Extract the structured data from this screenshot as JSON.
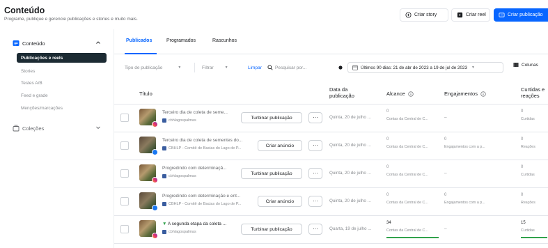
{
  "header": {
    "title": "Conteúdo",
    "subtitle": "Programe, publique e gerencie publicações e stories e muito mais.",
    "buttons": {
      "create_story": "Criar story",
      "create_reel": "Criar reel",
      "create_post": "Criar publicação"
    }
  },
  "sidebar": {
    "content_label": "Conteúdo",
    "sub_items": [
      "Publicações e reels",
      "Stories",
      "Testes A/B",
      "Feed e grade",
      "Menções/marcações"
    ],
    "collections_label": "Coleções"
  },
  "tabs": [
    "Publicados",
    "Programados",
    "Rascunhos"
  ],
  "filters": {
    "post_type": "Tipo de publicação",
    "filter": "Filtrar",
    "clear": "Limpar",
    "search": "Pesquisar por...",
    "date_range": "Últimos 90 dias: 21 de abr de 2023 a 19 de jul de 2023",
    "columns": "Colunas"
  },
  "table": {
    "headers": {
      "title": "Título",
      "date_l1": "Data da",
      "date_l2": "publicação",
      "reach": "Alcance",
      "engagement": "Engajamentos",
      "likes_l1": "Curtidas e",
      "likes_l2": "reações"
    },
    "rows": [
      {
        "title": "Terceiro dia de coleta de seme...",
        "account": "cbhlagospalmas",
        "network": "instagram",
        "action": "Turbinar publicação",
        "date": "Quinta, 20 de julho ...",
        "reach_value": "0",
        "reach_label": "Contas da Central de C...",
        "engagement_value": "",
        "engagement_label": "",
        "likes_value": "0",
        "likes_label": "Curtidas"
      },
      {
        "title": "Terceiro dia de coleta de sementes do...",
        "account": "CBHLP - Comitê de Bacias do Lago de P...",
        "network": "facebook",
        "action": "Criar anúncio",
        "date": "Quinta, 20 de julho ...",
        "reach_value": "0",
        "reach_label": "Contas da Central de C...",
        "engagement_value": "0",
        "engagement_label": "Engajamentos com a p...",
        "likes_value": "0",
        "likes_label": "Reações"
      },
      {
        "title": "Progredindo com determinaçã...",
        "account": "cbhlagospalmas",
        "network": "instagram",
        "action": "Turbinar publicação",
        "date": "Quinta, 20 de julho ...",
        "reach_value": "0",
        "reach_label": "Contas da Central de C...",
        "engagement_value": "",
        "engagement_label": "",
        "likes_value": "0",
        "likes_label": "Curtidas"
      },
      {
        "title": "Progredindo com determinação e ent...",
        "account": "CBHLP - Comitê de Bacias do Lago de P...",
        "network": "facebook",
        "action": "Criar anúncio",
        "date": "Quinta, 20 de julho ...",
        "reach_value": "0",
        "reach_label": "Contas da Central de C...",
        "engagement_value": "0",
        "engagement_label": "Engajamentos com a p...",
        "likes_value": "0",
        "likes_label": "Reações"
      },
      {
        "title": "A segunda etapa da coleta ...",
        "account": "cbhlagospalmas",
        "network": "instagram",
        "action": "Turbinar publicação",
        "date": "Quarta, 19 de julho ...",
        "reach_value": "34",
        "reach_label": "Contas da Central de C...",
        "engagement_value": "",
        "engagement_label": "",
        "likes_value": "15",
        "likes_label": "Curtidas"
      }
    ]
  },
  "colors": {
    "accent": "#0866ff",
    "active_nav": "#1c2b33",
    "positive": "#31a24c"
  }
}
